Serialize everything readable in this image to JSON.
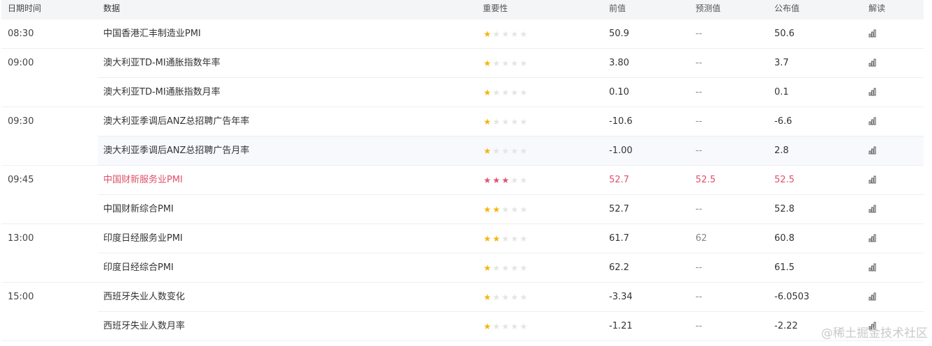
{
  "header": {
    "time": "日期时间",
    "data": "数据",
    "importance": "重要性",
    "previous": "前值",
    "forecast": "预测值",
    "published": "公布值",
    "interpret": "解读"
  },
  "rows": [
    {
      "time": "08:30",
      "name": "中国香港汇丰制造业PMI",
      "stars": 1,
      "previous": "50.9",
      "forecast": "--",
      "published": "50.6"
    },
    {
      "time": "09:00",
      "name": "澳大利亚TD-MI通胀指数年率",
      "stars": 1,
      "previous": "3.80",
      "forecast": "--",
      "published": "3.7"
    },
    {
      "time": "",
      "name": "澳大利亚TD-MI通胀指数月率",
      "stars": 1,
      "previous": "0.10",
      "forecast": "--",
      "published": "0.1"
    },
    {
      "time": "09:30",
      "name": "澳大利亚季调后ANZ总招聘广告年率",
      "stars": 1,
      "previous": "-10.6",
      "forecast": "--",
      "published": "-6.6"
    },
    {
      "time": "",
      "name": "澳大利亚季调后ANZ总招聘广告月率",
      "stars": 1,
      "previous": "-1.00",
      "forecast": "--",
      "published": "2.8"
    },
    {
      "time": "09:45",
      "name": "中国财新服务业PMI",
      "stars": 3,
      "previous": "52.7",
      "forecast": "52.5",
      "published": "52.5"
    },
    {
      "time": "",
      "name": "中国财新综合PMI",
      "stars": 2,
      "previous": "52.7",
      "forecast": "--",
      "published": "52.8"
    },
    {
      "time": "13:00",
      "name": "印度日经服务业PMI",
      "stars": 2,
      "previous": "61.7",
      "forecast": "62",
      "published": "60.8"
    },
    {
      "time": "",
      "name": "印度日经综合PMI",
      "stars": 1,
      "previous": "62.2",
      "forecast": "--",
      "published": "61.5"
    },
    {
      "time": "15:00",
      "name": "西班牙失业人数变化",
      "stars": 1,
      "previous": "-3.34",
      "forecast": "--",
      "published": "-6.0503"
    },
    {
      "time": "",
      "name": "西班牙失业人数月率",
      "stars": 1,
      "previous": "-1.21",
      "forecast": "--",
      "published": "-2.22"
    }
  ],
  "watermark": "@稀土掘金技术社区",
  "colors": {
    "star_on": "#f5b400",
    "star_off": "#e4e4e4",
    "highlight": "#e0506a",
    "header_bg": "#f4f5f7"
  },
  "icons": {
    "interpret": "bar-chart-icon",
    "importance": "star-icon"
  }
}
